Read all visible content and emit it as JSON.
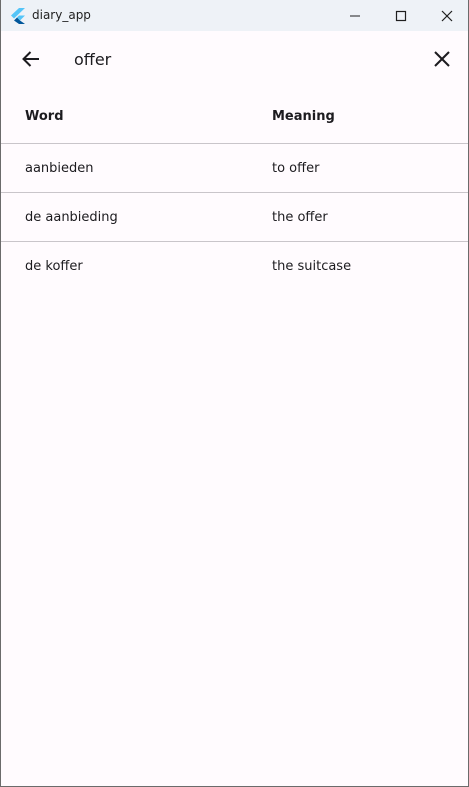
{
  "window": {
    "title": "diary_app"
  },
  "icons": {
    "app_logo": "flutter-logo",
    "minimize": "minimize-icon",
    "maximize": "maximize-icon",
    "close": "close-icon",
    "back": "arrow-back-icon",
    "clear": "clear-icon"
  },
  "search": {
    "value": "offer",
    "placeholder": ""
  },
  "table": {
    "headers": {
      "word": "Word",
      "meaning": "Meaning"
    },
    "rows": [
      {
        "word": "aanbieden",
        "meaning": "to offer"
      },
      {
        "word": "de aanbieding",
        "meaning": "the offer"
      },
      {
        "word": "de koffer",
        "meaning": "the suitcase"
      }
    ]
  },
  "colors": {
    "background": "#fffbfe",
    "titlebar": "#eef2f7",
    "divider": "#c9c5ca",
    "text": "#1c1b1f",
    "logo_light": "#54c5f8",
    "logo_dark": "#01579b"
  }
}
